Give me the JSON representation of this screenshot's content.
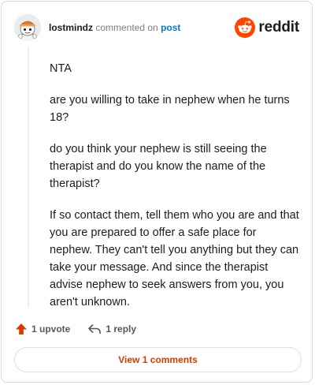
{
  "header": {
    "username": "lostmindz",
    "action_text": "commented on",
    "post_link": "post",
    "brand_name": "reddit",
    "brand_color": "#ff4500"
  },
  "comment": {
    "paragraphs": [
      "NTA",
      "are you willing to take in nephew when he turns 18?",
      "do you think your nephew is still seeing the therapist and do you know the name of the therapist?",
      "If so contact them, tell them who you are and that you are prepared to offer a safe place for nephew. They can't tell you anything but they can take your message. And since the therapist advise nephew to seek answers from you, you aren't unknown."
    ]
  },
  "actions": {
    "upvote_label": "1 upvote",
    "reply_label": "1 reply",
    "upvote_icon": "upvote-arrow-icon",
    "reply_icon": "reply-arrow-icon"
  },
  "footer": {
    "view_comments_label": "View 1 comments"
  }
}
